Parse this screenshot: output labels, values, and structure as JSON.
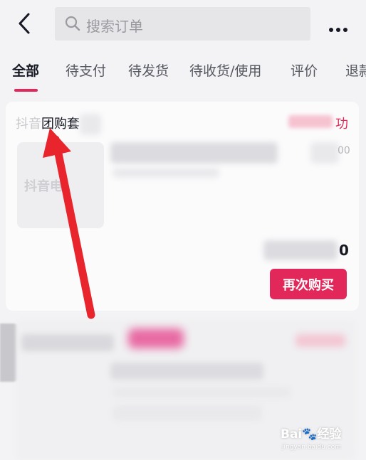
{
  "search": {
    "placeholder": "搜索订单"
  },
  "tabs": [
    {
      "label": "全部",
      "active": true
    },
    {
      "label": "待支付"
    },
    {
      "label": "待发货"
    },
    {
      "label": "待收货/使用"
    },
    {
      "label": "评价"
    },
    {
      "label": "退款"
    }
  ],
  "order": {
    "brand_prefix": "抖音",
    "brand_text": "团购套",
    "status_tail": "功",
    "price_tail": "00",
    "total_tail": "0",
    "thumb_logo": "抖音电",
    "rebuy_label": "再次购买"
  },
  "watermark": {
    "text": "Bai🐾经验",
    "sub": "jingyan.baidu.com"
  },
  "colors": {
    "accent": "#e2285a",
    "arrow": "#e8252d"
  }
}
